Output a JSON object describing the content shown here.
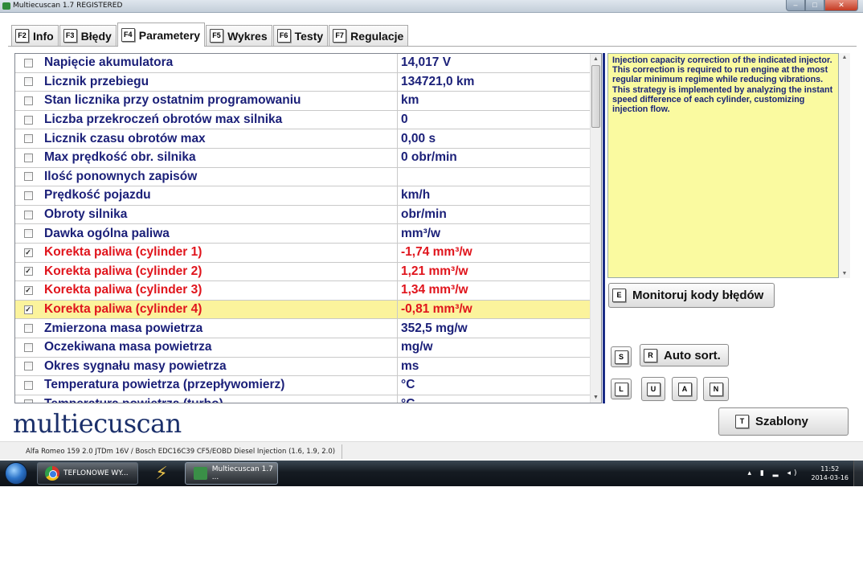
{
  "window": {
    "title": "Multiecuscan 1.7 REGISTERED"
  },
  "tabs": [
    {
      "key": "F2",
      "label": "Info",
      "active": false
    },
    {
      "key": "F3",
      "label": "Błędy",
      "active": false
    },
    {
      "key": "F4",
      "label": "Parametery",
      "active": true
    },
    {
      "key": "F5",
      "label": "Wykres",
      "active": false
    },
    {
      "key": "F6",
      "label": "Testy",
      "active": false
    },
    {
      "key": "F7",
      "label": "Regulacje",
      "active": false
    }
  ],
  "parameters": [
    {
      "name": "Napięcie akumulatora",
      "value": "14,017 V",
      "checked": false,
      "highlight": false,
      "selected": false
    },
    {
      "name": "Licznik przebiegu",
      "value": "134721,0 km",
      "checked": false,
      "highlight": false,
      "selected": false
    },
    {
      "name": "Stan licznika przy ostatnim programowaniu",
      "value": " km",
      "checked": false,
      "highlight": false,
      "selected": false
    },
    {
      "name": "Liczba przekroczeń obrotów max silnika",
      "value": "0",
      "checked": false,
      "highlight": false,
      "selected": false
    },
    {
      "name": "Licznik czasu obrotów max",
      "value": "0,00 s",
      "checked": false,
      "highlight": false,
      "selected": false
    },
    {
      "name": "Max prędkość obr. silnika",
      "value": "0 obr/min",
      "checked": false,
      "highlight": false,
      "selected": false
    },
    {
      "name": "Ilość ponownych zapisów",
      "value": "",
      "checked": false,
      "highlight": false,
      "selected": false
    },
    {
      "name": "Prędkość pojazdu",
      "value": " km/h",
      "checked": false,
      "highlight": false,
      "selected": false
    },
    {
      "name": "Obroty silnika",
      "value": " obr/min",
      "checked": false,
      "highlight": false,
      "selected": false
    },
    {
      "name": "Dawka ogólna paliwa",
      "value": " mm³/w",
      "checked": false,
      "highlight": false,
      "selected": false
    },
    {
      "name": "Korekta paliwa (cylinder 1)",
      "value": "-1,74 mm³/w",
      "checked": true,
      "highlight": true,
      "selected": false
    },
    {
      "name": "Korekta paliwa (cylinder 2)",
      "value": "1,21 mm³/w",
      "checked": true,
      "highlight": true,
      "selected": false
    },
    {
      "name": "Korekta paliwa (cylinder 3)",
      "value": "1,34 mm³/w",
      "checked": true,
      "highlight": true,
      "selected": false
    },
    {
      "name": "Korekta paliwa (cylinder 4)",
      "value": "-0,81 mm³/w",
      "checked": true,
      "highlight": true,
      "selected": true
    },
    {
      "name": "Zmierzona masa powietrza",
      "value": "352,5 mg/w",
      "checked": false,
      "highlight": false,
      "selected": false
    },
    {
      "name": "Oczekiwana masa powietrza",
      "value": " mg/w",
      "checked": false,
      "highlight": false,
      "selected": false
    },
    {
      "name": "Okres sygnału masy powietrza",
      "value": " ms",
      "checked": false,
      "highlight": false,
      "selected": false
    },
    {
      "name": "Temperatura powietrza (przepływomierz)",
      "value": " °C",
      "checked": false,
      "highlight": false,
      "selected": false
    },
    {
      "name": "Temperatura powietrza (turbo)",
      "value": " °C",
      "checked": false,
      "highlight": false,
      "selected": false
    }
  ],
  "description": "Injection capacity correction of the indicated injector. This correction is required to run engine at the most regular minimum regime while reducing vibrations.\nThis strategy is implemented by analyzing the instant speed difference of each cylinder, customizing injection flow.",
  "buttons": {
    "monitor": {
      "key": "E",
      "label": "Monitoruj kody błędów"
    },
    "s": {
      "key": "S"
    },
    "autosort": {
      "key": "R",
      "label": "Auto sort."
    },
    "l": {
      "key": "L"
    },
    "u": {
      "key": "U"
    },
    "a": {
      "key": "A"
    },
    "n": {
      "key": "N"
    },
    "szablony": {
      "key": "T",
      "label": "Szablony"
    }
  },
  "logo": "multiecuscan",
  "status": "Alfa Romeo 159 2.0 JTDm 16V / Bosch EDC16C39 CF5/EOBD Diesel Injection (1.6, 1.9, 2.0)",
  "taskbar": {
    "items": [
      {
        "label": "TEFLONOWE WY...",
        "icon": "chrome-icon"
      },
      {
        "label": "",
        "icon": "pinned-app-icon"
      },
      {
        "label": "Multiecuscan 1.7 ...",
        "icon": "multiecuscan-icon"
      }
    ],
    "clock": {
      "time": "11:52",
      "date": "2014-03-16"
    }
  },
  "colors": {
    "value_text": "#1a1f78",
    "highlight_text": "#e0141c",
    "selected_row": "#fbf39c",
    "description_bg": "#fafaa0"
  }
}
